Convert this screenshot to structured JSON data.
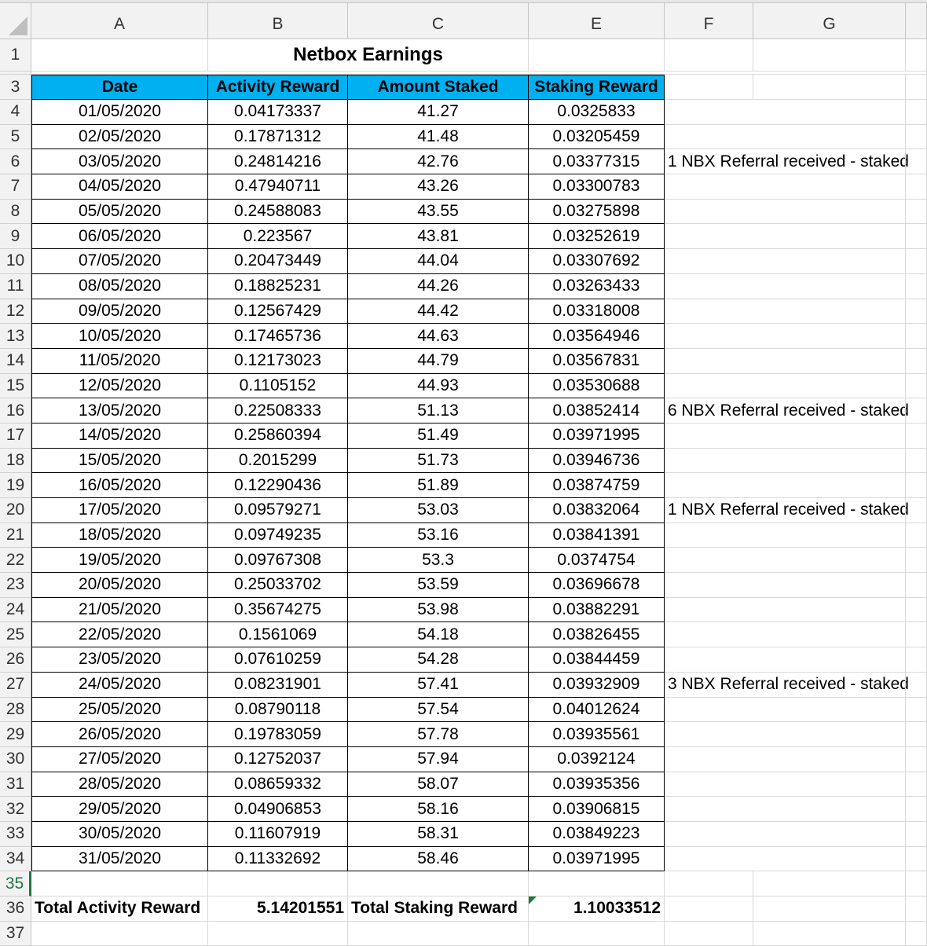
{
  "columns": [
    "A",
    "B",
    "C",
    "E",
    "F",
    "G"
  ],
  "title": "Netbox Earnings",
  "table": {
    "headers": [
      "Date",
      "Activity Reward",
      "Amount Staked",
      "Staking Reward"
    ],
    "rows": [
      {
        "row": "4",
        "date": "01/05/2020",
        "activity": "0.04173337",
        "staked": "41.27",
        "staking": "0.0325833",
        "note": ""
      },
      {
        "row": "5",
        "date": "02/05/2020",
        "activity": "0.17871312",
        "staked": "41.48",
        "staking": "0.03205459",
        "note": ""
      },
      {
        "row": "6",
        "date": "03/05/2020",
        "activity": "0.24814216",
        "staked": "42.76",
        "staking": "0.03377315",
        "note": "1 NBX Referral received - staked"
      },
      {
        "row": "7",
        "date": "04/05/2020",
        "activity": "0.47940711",
        "staked": "43.26",
        "staking": "0.03300783",
        "note": ""
      },
      {
        "row": "8",
        "date": "05/05/2020",
        "activity": "0.24588083",
        "staked": "43.55",
        "staking": "0.03275898",
        "note": ""
      },
      {
        "row": "9",
        "date": "06/05/2020",
        "activity": "0.223567",
        "staked": "43.81",
        "staking": "0.03252619",
        "note": ""
      },
      {
        "row": "10",
        "date": "07/05/2020",
        "activity": "0.20473449",
        "staked": "44.04",
        "staking": "0.03307692",
        "note": ""
      },
      {
        "row": "11",
        "date": "08/05/2020",
        "activity": "0.18825231",
        "staked": "44.26",
        "staking": "0.03263433",
        "note": ""
      },
      {
        "row": "12",
        "date": "09/05/2020",
        "activity": "0.12567429",
        "staked": "44.42",
        "staking": "0.03318008",
        "note": ""
      },
      {
        "row": "13",
        "date": "10/05/2020",
        "activity": "0.17465736",
        "staked": "44.63",
        "staking": "0.03564946",
        "note": ""
      },
      {
        "row": "14",
        "date": "11/05/2020",
        "activity": "0.12173023",
        "staked": "44.79",
        "staking": "0.03567831",
        "note": ""
      },
      {
        "row": "15",
        "date": "12/05/2020",
        "activity": "0.1105152",
        "staked": "44.93",
        "staking": "0.03530688",
        "note": ""
      },
      {
        "row": "16",
        "date": "13/05/2020",
        "activity": "0.22508333",
        "staked": "51.13",
        "staking": "0.03852414",
        "note": "6 NBX Referral received - staked"
      },
      {
        "row": "17",
        "date": "14/05/2020",
        "activity": "0.25860394",
        "staked": "51.49",
        "staking": "0.03971995",
        "note": ""
      },
      {
        "row": "18",
        "date": "15/05/2020",
        "activity": "0.2015299",
        "staked": "51.73",
        "staking": "0.03946736",
        "note": ""
      },
      {
        "row": "19",
        "date": "16/05/2020",
        "activity": "0.12290436",
        "staked": "51.89",
        "staking": "0.03874759",
        "note": ""
      },
      {
        "row": "20",
        "date": "17/05/2020",
        "activity": "0.09579271",
        "staked": "53.03",
        "staking": "0.03832064",
        "note": "1 NBX Referral received - staked"
      },
      {
        "row": "21",
        "date": "18/05/2020",
        "activity": "0.09749235",
        "staked": "53.16",
        "staking": "0.03841391",
        "note": ""
      },
      {
        "row": "22",
        "date": "19/05/2020",
        "activity": "0.09767308",
        "staked": "53.3",
        "staking": "0.0374754",
        "note": ""
      },
      {
        "row": "23",
        "date": "20/05/2020",
        "activity": "0.25033702",
        "staked": "53.59",
        "staking": "0.03696678",
        "note": ""
      },
      {
        "row": "24",
        "date": "21/05/2020",
        "activity": "0.35674275",
        "staked": "53.98",
        "staking": "0.03882291",
        "note": ""
      },
      {
        "row": "25",
        "date": "22/05/2020",
        "activity": "0.1561069",
        "staked": "54.18",
        "staking": "0.03826455",
        "note": ""
      },
      {
        "row": "26",
        "date": "23/05/2020",
        "activity": "0.07610259",
        "staked": "54.28",
        "staking": "0.03844459",
        "note": ""
      },
      {
        "row": "27",
        "date": "24/05/2020",
        "activity": "0.08231901",
        "staked": "57.41",
        "staking": "0.03932909",
        "note": "3 NBX Referral received - staked"
      },
      {
        "row": "28",
        "date": "25/05/2020",
        "activity": "0.08790118",
        "staked": "57.54",
        "staking": "0.04012624",
        "note": ""
      },
      {
        "row": "29",
        "date": "26/05/2020",
        "activity": "0.19783059",
        "staked": "57.78",
        "staking": "0.03935561",
        "note": ""
      },
      {
        "row": "30",
        "date": "27/05/2020",
        "activity": "0.12752037",
        "staked": "57.94",
        "staking": "0.0392124",
        "note": ""
      },
      {
        "row": "31",
        "date": "28/05/2020",
        "activity": "0.08659332",
        "staked": "58.07",
        "staking": "0.03935356",
        "note": ""
      },
      {
        "row": "32",
        "date": "29/05/2020",
        "activity": "0.04906853",
        "staked": "58.16",
        "staking": "0.03906815",
        "note": ""
      },
      {
        "row": "33",
        "date": "30/05/2020",
        "activity": "0.11607919",
        "staked": "58.31",
        "staking": "0.03849223",
        "note": ""
      },
      {
        "row": "34",
        "date": "31/05/2020",
        "activity": "0.11332692",
        "staked": "58.46",
        "staking": "0.03971995",
        "note": ""
      }
    ]
  },
  "totals": {
    "activity_label": "Total Activity Reward",
    "activity_value": "5.14201551",
    "staking_label": "Total Staking Reward",
    "staking_value": "1.10033512"
  },
  "row_numbers": {
    "title": "1",
    "header": "3",
    "empty": "35",
    "totals": "36",
    "last": "37"
  },
  "colors": {
    "header_fill": "#00b0f0",
    "selection": "#217346"
  }
}
